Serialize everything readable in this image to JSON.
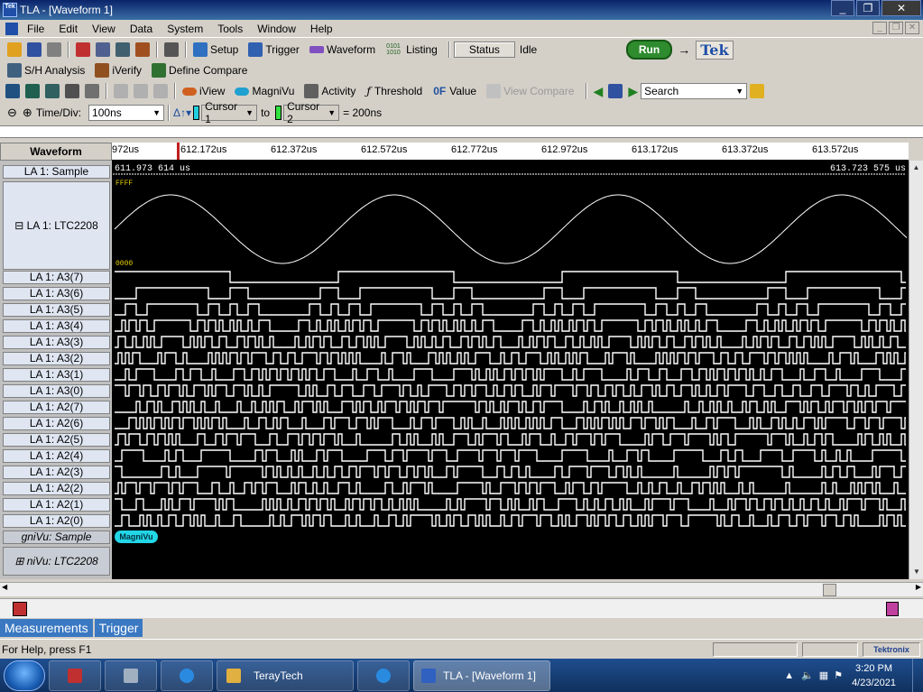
{
  "window": {
    "title": "TLA - [Waveform 1]",
    "app_icon_text": "Tek"
  },
  "menu": [
    "File",
    "Edit",
    "View",
    "Data",
    "System",
    "Tools",
    "Window",
    "Help"
  ],
  "toolbar1": {
    "setup": "Setup",
    "trigger": "Trigger",
    "waveform": "Waveform",
    "listing_icon": "0101\n1010",
    "listing": "Listing",
    "status_btn": "Status",
    "status_value": "Idle",
    "run": "Run",
    "tek": "Tek"
  },
  "toolbar2": {
    "sh_analysis": "S/H Analysis",
    "iverify": "iVerify",
    "define_compare": "Define Compare"
  },
  "toolbar3": {
    "iview": "iView",
    "magnivu": "MagniVu",
    "activity": "Activity",
    "threshold": "Threshold",
    "value_icon": "0F",
    "value": "Value",
    "view_compare": "View Compare",
    "search": "Search"
  },
  "toolbar4": {
    "time_div_label": "Time/Div:",
    "time_div_value": "100ns",
    "cursor1": "Cursor 1",
    "to": "to",
    "cursor2": "Cursor 2",
    "delta": "= 200ns"
  },
  "waveform_header": "Waveform",
  "ruler_ticks": [
    "972us",
    "612.172us",
    "612.372us",
    "612.572us",
    "612.772us",
    "612.972us",
    "613.172us",
    "613.372us",
    "613.572us"
  ],
  "range_start": "611.973 614 us",
  "range_end": "613.723 575 us",
  "analog_max": "FFFF",
  "analog_min": "0000",
  "channels": [
    {
      "name": "LA 1: Sample"
    },
    {
      "name": "LA 1: LTC2208"
    },
    {
      "name": "LA 1: A3(7)"
    },
    {
      "name": "LA 1: A3(6)"
    },
    {
      "name": "LA 1: A3(5)"
    },
    {
      "name": "LA 1: A3(4)"
    },
    {
      "name": "LA 1: A3(3)"
    },
    {
      "name": "LA 1: A3(2)"
    },
    {
      "name": "LA 1: A3(1)"
    },
    {
      "name": "LA 1: A3(0)"
    },
    {
      "name": "LA 1: A2(7)"
    },
    {
      "name": "LA 1: A2(6)"
    },
    {
      "name": "LA 1: A2(5)"
    },
    {
      "name": "LA 1: A2(4)"
    },
    {
      "name": "LA 1: A2(3)"
    },
    {
      "name": "LA 1: A2(2)"
    },
    {
      "name": "LA 1: A2(1)"
    },
    {
      "name": "LA 1: A2(0)"
    },
    {
      "name": "gniVu: Sample"
    },
    {
      "name": "niVu: LTC2208"
    }
  ],
  "magnivu_tag": "MagniVu",
  "tabs": [
    "Measurements",
    "Trigger"
  ],
  "status": {
    "help": "For Help, press F1",
    "brand": "Tektronix"
  },
  "taskbar": {
    "items": [
      "TerayTech",
      "TLA - [Waveform 1]"
    ],
    "time": "3:20 PM",
    "date": "4/23/2021"
  },
  "colors": {
    "plot_bg": "#000000",
    "trace": "#ffffff",
    "analog_label": "#e8d000",
    "magnivu": "#22d6e6",
    "channel_bg": "#dfe6f2",
    "tab_bg": "#3a78c2"
  }
}
